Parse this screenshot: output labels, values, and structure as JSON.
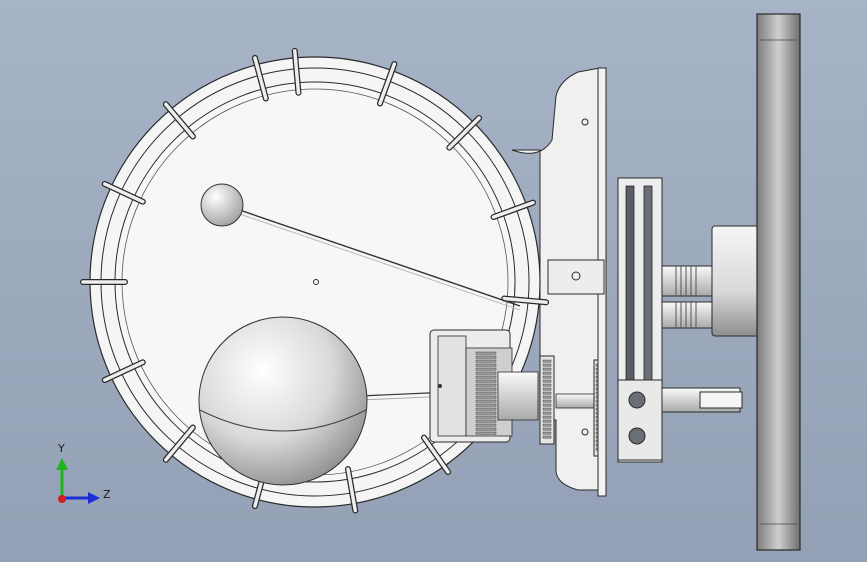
{
  "axes": {
    "y_label": "Y",
    "z_label": "Z",
    "y_color": "#1fb51f",
    "z_color": "#1c2fd6",
    "x_color": "#d61c1c"
  },
  "colors": {
    "background": "#a0acbf",
    "part_fill": "#f2f2f2",
    "part_stroke": "#2a2a2a",
    "dark_part": "#5a5e66"
  },
  "icons": [
    "triad-icon",
    "sphere-icon",
    "gear-icon",
    "flywheel-icon"
  ]
}
